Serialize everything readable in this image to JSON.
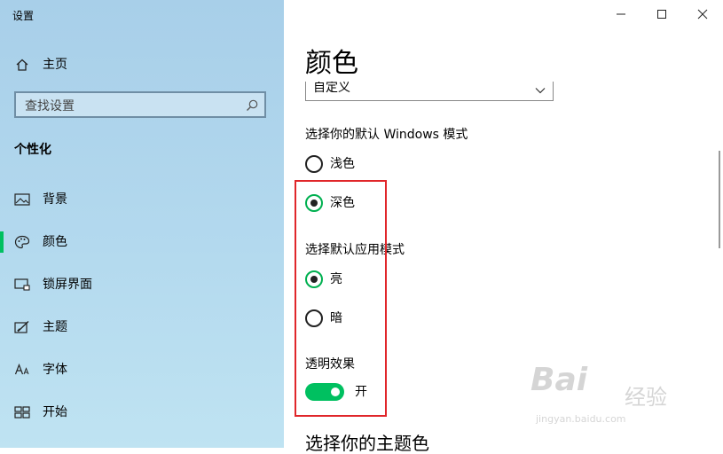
{
  "window": {
    "title": "设置"
  },
  "sidebar": {
    "home_label": "主页",
    "search_placeholder": "查找设置",
    "section_title": "个性化",
    "items": [
      {
        "label": "背景",
        "icon": "image-icon"
      },
      {
        "label": "颜色",
        "icon": "palette-icon",
        "active": true
      },
      {
        "label": "锁屏界面",
        "icon": "lock-screen-icon"
      },
      {
        "label": "主题",
        "icon": "theme-icon"
      },
      {
        "label": "字体",
        "icon": "font-icon"
      },
      {
        "label": "开始",
        "icon": "start-icon"
      }
    ]
  },
  "main": {
    "title": "颜色",
    "dropdown_value": "自定义",
    "windows_mode": {
      "label": "选择你的默认 Windows 模式",
      "options": [
        "浅色",
        "深色"
      ],
      "selected": "深色"
    },
    "app_mode": {
      "label": "选择默认应用模式",
      "options": [
        "亮",
        "暗"
      ],
      "selected": "亮"
    },
    "transparency": {
      "label": "透明效果",
      "state": "开",
      "on": true
    },
    "next_section": "选择你的主题色"
  },
  "watermark": {
    "brand": "Bai",
    "site": "经验",
    "url": "jingyan.baidu.com"
  },
  "colors": {
    "accent": "#00c060",
    "highlight": "#e0262a"
  }
}
